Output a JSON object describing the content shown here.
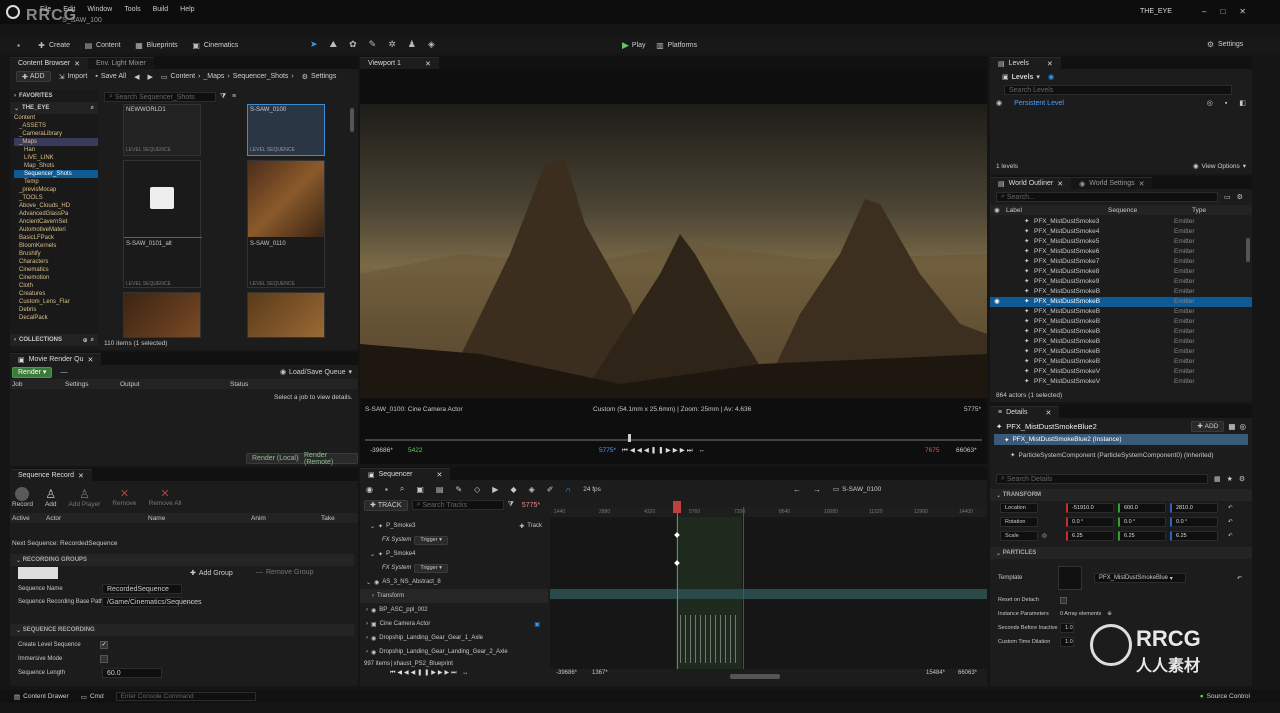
{
  "app": {
    "logo_text": "RRCG",
    "project": "S_SAW_100",
    "window_title": "THE_EYE"
  },
  "menu": [
    "File",
    "Edit",
    "Window",
    "Tools",
    "Build",
    "Help"
  ],
  "toolbar": {
    "save": "",
    "create": "Create",
    "content": "Content",
    "blueprints": "Blueprints",
    "cinematics": "Cinematics",
    "play": "Play",
    "platforms": "Platforms",
    "settings": "Settings"
  },
  "content_browser": {
    "tabs": [
      "Content Browser",
      "Env. Light Mixer"
    ],
    "add": "ADD",
    "import": "Import",
    "save_all": "Save All",
    "path": [
      "Content",
      "_Maps",
      "Sequencer_Shots"
    ],
    "settings": "Settings",
    "favorites": "FAVORITES",
    "project": "THE_EYE",
    "search_placeholder": "Search Sequencer_Shots",
    "tree": [
      "Content",
      "_ASSETS",
      "_CameraLibrary",
      "_Maps",
      "Han",
      "LIVE_LINK",
      "Map_Shots",
      "Sequencer_Shots",
      "Temp",
      "_previsMocap",
      "_TOOLS",
      "Above_Clouds_HD",
      "AdvancedGlassPa",
      "AncientCavernSet",
      "AutomotiveMateri",
      "BasicLFPack",
      "BloomKernels",
      "Brushify",
      "Characters",
      "Cinematics",
      "Cinemotion",
      "Cloth",
      "Creatures",
      "Custom_Lens_Flar",
      "Debris",
      "DecalPack"
    ],
    "collections": "COLLECTIONS",
    "assets": [
      {
        "name": "NEWWORLD1",
        "type": "LEVEL SEQUENCE"
      },
      {
        "name": "S-SAW_0100",
        "type": "LEVEL SEQUENCE"
      },
      {
        "name": "S-SAW_0101_alt",
        "type": "LEVEL SEQUENCE"
      },
      {
        "name": "S-SAW_0110",
        "type": "LEVEL SEQUENCE"
      }
    ],
    "status": "110 items (1 selected)"
  },
  "movie_render": {
    "tab": "Movie Render Qu",
    "render": "Render",
    "load_save": "Load/Save Queue",
    "cols": [
      "Job",
      "Settings",
      "Output",
      "Status"
    ],
    "hint": "Select a job to view details.",
    "render_local": "Render (Local)",
    "render_remote": "Render (Remote)"
  },
  "sequence_record": {
    "tab": "Sequence Record",
    "buttons": [
      "Record",
      "Add",
      "Add Player",
      "Remove",
      "Remove All"
    ],
    "cols": [
      "Active",
      "Actor",
      "Name",
      "Anim",
      "Take"
    ],
    "next": "Next Sequence: RecordedSequence",
    "groups": "RECORDING GROUPS",
    "add_group": "Add Group",
    "remove_group": "Remove Group",
    "seq_name_label": "Sequence Name",
    "seq_name": "RecordedSequence",
    "base_path_label": "Sequence Recording Base Path",
    "base_path": "/Game/Cinematics/Sequences",
    "recording": "SEQUENCE RECORDING",
    "props": [
      "Create Level Sequence",
      "Immersive Mode",
      "Sequence Length"
    ],
    "length": "60.0"
  },
  "viewport": {
    "tab": "Viewport 1",
    "camera": "S-SAW_0100: Cine Camera Actor",
    "info": "Custom (54.1mm x 25.6mm) | Zoom: 25mm | Av: 4.636",
    "frame": "5775*",
    "start": "-39686*",
    "in": "5422",
    "cur": "5775*",
    "out": "7675",
    "end": "66063*"
  },
  "sequencer": {
    "tab": "Sequencer",
    "fps": "24 fps",
    "shot": "S-SAW_0100",
    "track": "TRACK",
    "search": "Search Tracks",
    "current": "5775*",
    "ruler": [
      "1440",
      "2880",
      "4320",
      "5760",
      "7200",
      "8640",
      "10080",
      "11520",
      "12960",
      "14400"
    ],
    "tracks": [
      "P_Smoke3",
      "FX System",
      "P_Smoke4",
      "FX System",
      "AS_3_NS_Abstract_8",
      "Transform",
      "BP_ASC_ppl_002",
      "Cine Camera Actor",
      "Dropship_Landing_Gear_Gear_1_Axle",
      "Dropship_Landing_Gear_Landing_Gear_2_Axle"
    ],
    "trigger": "Trigger",
    "add_track": "Track",
    "items": "997 items",
    "item_tail": "xhaust_PS2_Blueprint",
    "bottom": [
      "-39686*",
      "1367*",
      "15484*",
      "66063*"
    ]
  },
  "levels": {
    "tab": "Levels",
    "levels": "Levels",
    "search": "Search Levels",
    "persistent": "Persistent Level",
    "count": "1 levels",
    "view_options": "View Options"
  },
  "outliner": {
    "tabs": [
      "World Outliner",
      "World Settings"
    ],
    "search": "Search...",
    "cols": [
      "Label",
      "Sequence",
      "Type"
    ],
    "rows": [
      {
        "label": "PFX_MistDustSmoke3",
        "type": "Emitter"
      },
      {
        "label": "PFX_MistDustSmoke4",
        "type": "Emitter"
      },
      {
        "label": "PFX_MistDustSmoke5",
        "type": "Emitter"
      },
      {
        "label": "PFX_MistDustSmoke6",
        "type": "Emitter"
      },
      {
        "label": "PFX_MistDustSmoke7",
        "type": "Emitter"
      },
      {
        "label": "PFX_MistDustSmoke8",
        "type": "Emitter"
      },
      {
        "label": "PFX_MistDustSmoke9",
        "type": "Emitter"
      },
      {
        "label": "PFX_MistDustSmokeB",
        "type": "Emitter"
      },
      {
        "label": "PFX_MistDustSmokeB",
        "type": "Emitter"
      },
      {
        "label": "PFX_MistDustSmokeB",
        "type": "Emitter"
      },
      {
        "label": "PFX_MistDustSmokeB",
        "type": "Emitter"
      },
      {
        "label": "PFX_MistDustSmokeB",
        "type": "Emitter"
      },
      {
        "label": "PFX_MistDustSmokeB",
        "type": "Emitter"
      },
      {
        "label": "PFX_MistDustSmokeB",
        "type": "Emitter"
      },
      {
        "label": "PFX_MistDustSmokeB",
        "type": "Emitter"
      },
      {
        "label": "PFX_MistDustSmokeV",
        "type": "Emitter"
      },
      {
        "label": "PFX_MistDustSmokeV",
        "type": "Emitter"
      }
    ],
    "status": "864 actors (1 selected)"
  },
  "details": {
    "tab": "Details",
    "actor": "PFX_MistDustSmokeBlue2",
    "add": "ADD",
    "instance": "PFX_MistDustSmokeBlue2 (Instance)",
    "component": "ParticleSystemComponent (ParticleSystemComponent0) (Inherited)",
    "search": "Search Details",
    "transform": "TRANSFORM",
    "location": [
      "-51910.0",
      "600.0",
      "2810.0"
    ],
    "rotation": [
      "0.0 °",
      "0.0 °",
      "0.0 °"
    ],
    "scale": [
      "6.25",
      "6.25",
      "6.25"
    ],
    "labels": [
      "Location",
      "Rotation",
      "Scale"
    ],
    "particles": "PARTICLES",
    "template_label": "Template",
    "template": "PFX_MistDustSmokeBlue",
    "props": [
      "Reset on Detach",
      "Instance Parameters",
      "Seconds Before Inactive",
      "Custom Time Dilation"
    ],
    "inst_val": "0 Array elements",
    "sec_val": "1.0",
    "dil_val": "1.0"
  },
  "bottom": {
    "drawer": "Content Drawer",
    "cmd": "Cmd",
    "console": "Enter Console Command",
    "source": "Source Control"
  },
  "watermark": {
    "brand": "RRCG",
    "cn": "人人素材"
  }
}
